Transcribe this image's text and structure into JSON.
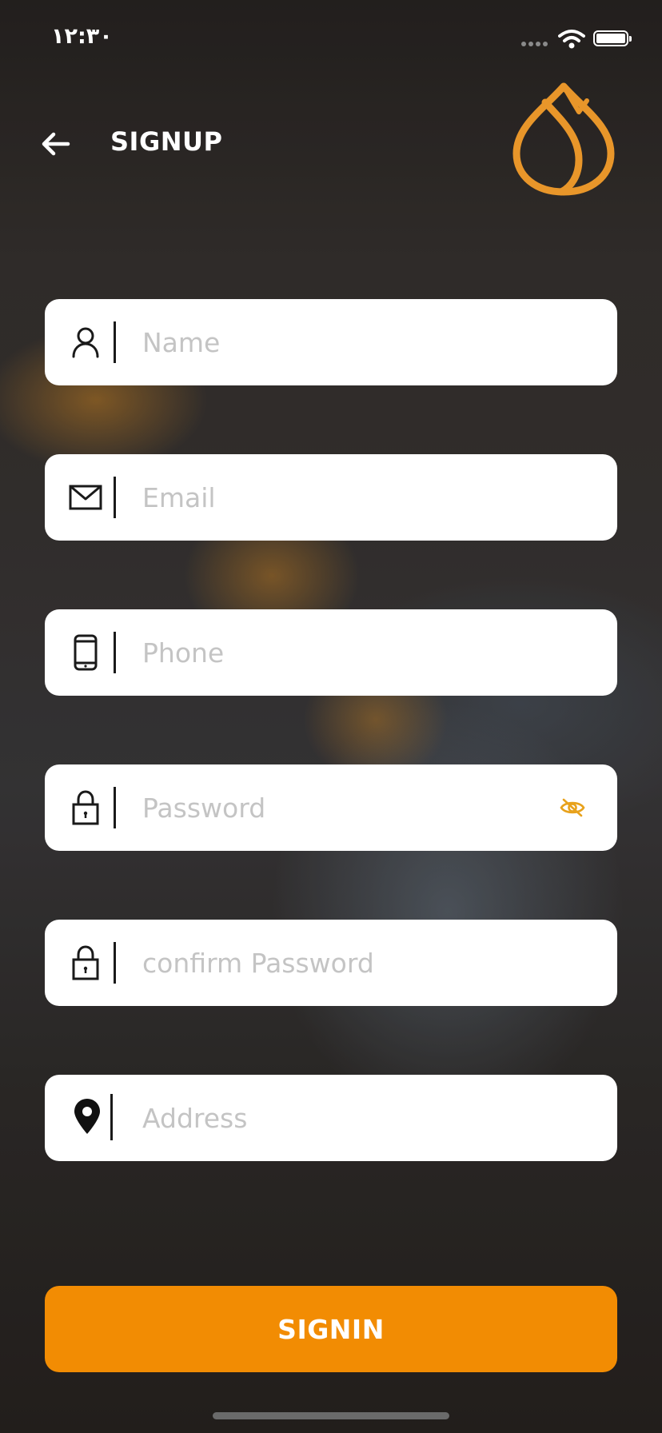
{
  "status_bar": {
    "time": "١٢:٣٠"
  },
  "header": {
    "title": "SIGNUP"
  },
  "form": {
    "name_placeholder": "Name",
    "email_placeholder": "Email",
    "phone_placeholder": "Phone",
    "password_placeholder": "Password",
    "confirm_password_placeholder": "confirm Password",
    "address_placeholder": "Address"
  },
  "submit_label": "SIGNIN",
  "icons": {
    "back": "arrow-left-icon",
    "logo": "drop-logo-icon",
    "name": "user-icon",
    "email": "envelope-icon",
    "phone": "phone-icon",
    "password": "lock-icon",
    "password_toggle": "eye-off-icon",
    "confirm_password": "lock-icon",
    "address": "map-pin-icon"
  },
  "colors": {
    "accent": "#f28c03",
    "logo": "#e8962a",
    "field_bg": "#ffffff",
    "placeholder": "#c4c4c4"
  }
}
